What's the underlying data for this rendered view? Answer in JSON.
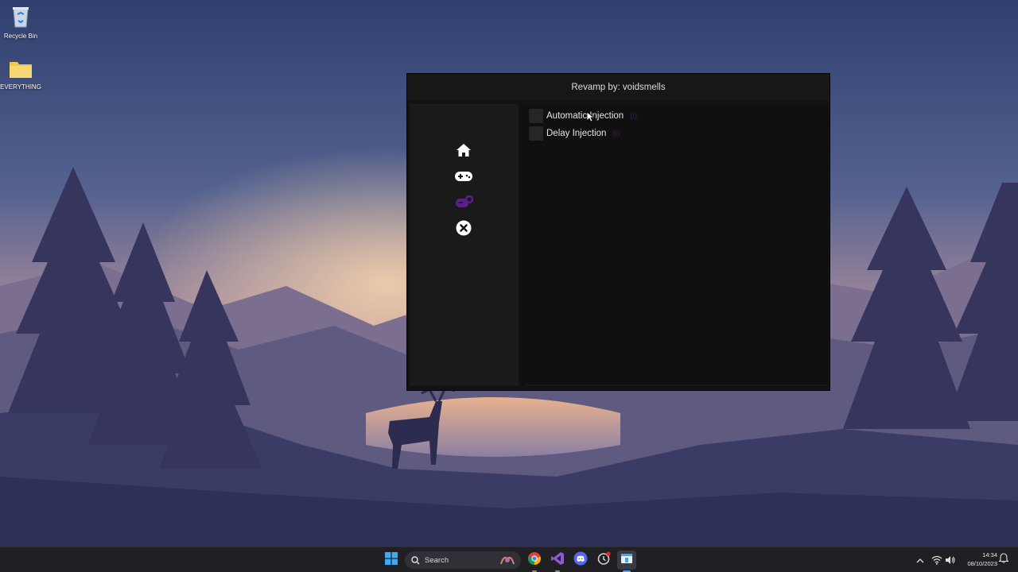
{
  "desktop": {
    "icons": [
      {
        "label": "Recycle Bin",
        "icon": "recycle-bin-icon"
      },
      {
        "label": "EVERYTHING",
        "icon": "folder-icon"
      }
    ]
  },
  "app": {
    "title": "Revamp by: voidsmells",
    "sidebar": [
      {
        "icon": "home-icon",
        "color": "#ffffff"
      },
      {
        "icon": "gamepad-icon",
        "color": "#ffffff"
      },
      {
        "icon": "settings-icon",
        "color": "#5a1f8a"
      },
      {
        "icon": "close-circle-icon",
        "color": "#ffffff"
      }
    ],
    "options": [
      {
        "label": "Automatic Injection",
        "checked": false,
        "badge": "(i)"
      },
      {
        "label": "Delay Injection",
        "checked": false,
        "badge": "(i)"
      }
    ],
    "colors": {
      "accent": "#5a1f8a",
      "background": "#121212",
      "sidebar": "#1a1a1a"
    }
  },
  "taskbar": {
    "search_placeholder": "Search",
    "apps": [
      "windows-start-icon",
      "search-icon",
      "chrome-icon",
      "visual-studio-icon",
      "discord-icon",
      "app-icon",
      "app-window-icon"
    ],
    "tray": {
      "time": "14:34",
      "date": "08/10/2023"
    }
  }
}
